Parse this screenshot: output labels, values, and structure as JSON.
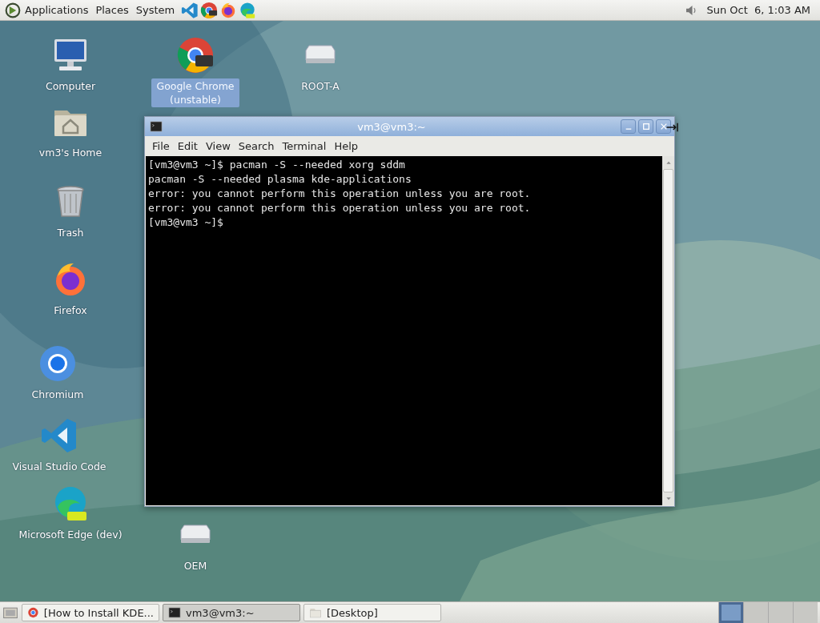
{
  "top_panel": {
    "menus": [
      {
        "label": "Applications"
      },
      {
        "label": "Places"
      },
      {
        "label": "System"
      }
    ],
    "launchers": [
      {
        "kind": "vscode"
      },
      {
        "kind": "chrome"
      },
      {
        "kind": "firefox"
      },
      {
        "kind": "edge"
      }
    ],
    "clock": "Sun Oct  6, 1:03 AM"
  },
  "desktop_icons": [
    {
      "kind": "computer",
      "label": "Computer",
      "selected": false
    },
    {
      "kind": "home",
      "label": "vm3's Home",
      "selected": false
    },
    {
      "kind": "trash",
      "label": "Trash",
      "selected": false
    },
    {
      "kind": "firefox",
      "label": "Firefox",
      "selected": false
    },
    {
      "kind": "chromium",
      "label": "Chromium",
      "selected": false
    },
    {
      "kind": "vscode",
      "label": "Visual Studio Code",
      "selected": false
    },
    {
      "kind": "edge",
      "label": "Microsoft Edge (dev)",
      "selected": false
    },
    {
      "kind": "chrome",
      "label": "Google Chrome (unstable)",
      "selected": true
    },
    {
      "kind": "drive",
      "label": "ROOT-A",
      "selected": false
    },
    {
      "kind": "drive",
      "label": "OEM",
      "selected": false
    }
  ],
  "terminal": {
    "title": "vm3@vm3:~",
    "menu": [
      "File",
      "Edit",
      "View",
      "Search",
      "Terminal",
      "Help"
    ],
    "lines": [
      "[vm3@vm3 ~]$ pacman -S --needed xorg sddm",
      "pacman -S --needed plasma kde-applications",
      "error: you cannot perform this operation unless you are root.",
      "error: you cannot perform this operation unless you are root.",
      "[vm3@vm3 ~]$"
    ]
  },
  "taskbar": {
    "tasks": [
      {
        "kind": "browser",
        "label": "[How to Install KDE...",
        "selected": false
      },
      {
        "kind": "terminal",
        "label": "vm3@vm3:~",
        "selected": true
      },
      {
        "kind": "folder",
        "label": "[Desktop]",
        "selected": false
      }
    ],
    "workspaces": [
      {
        "selected": true
      },
      {
        "selected": false
      },
      {
        "selected": false
      },
      {
        "selected": false
      }
    ]
  }
}
